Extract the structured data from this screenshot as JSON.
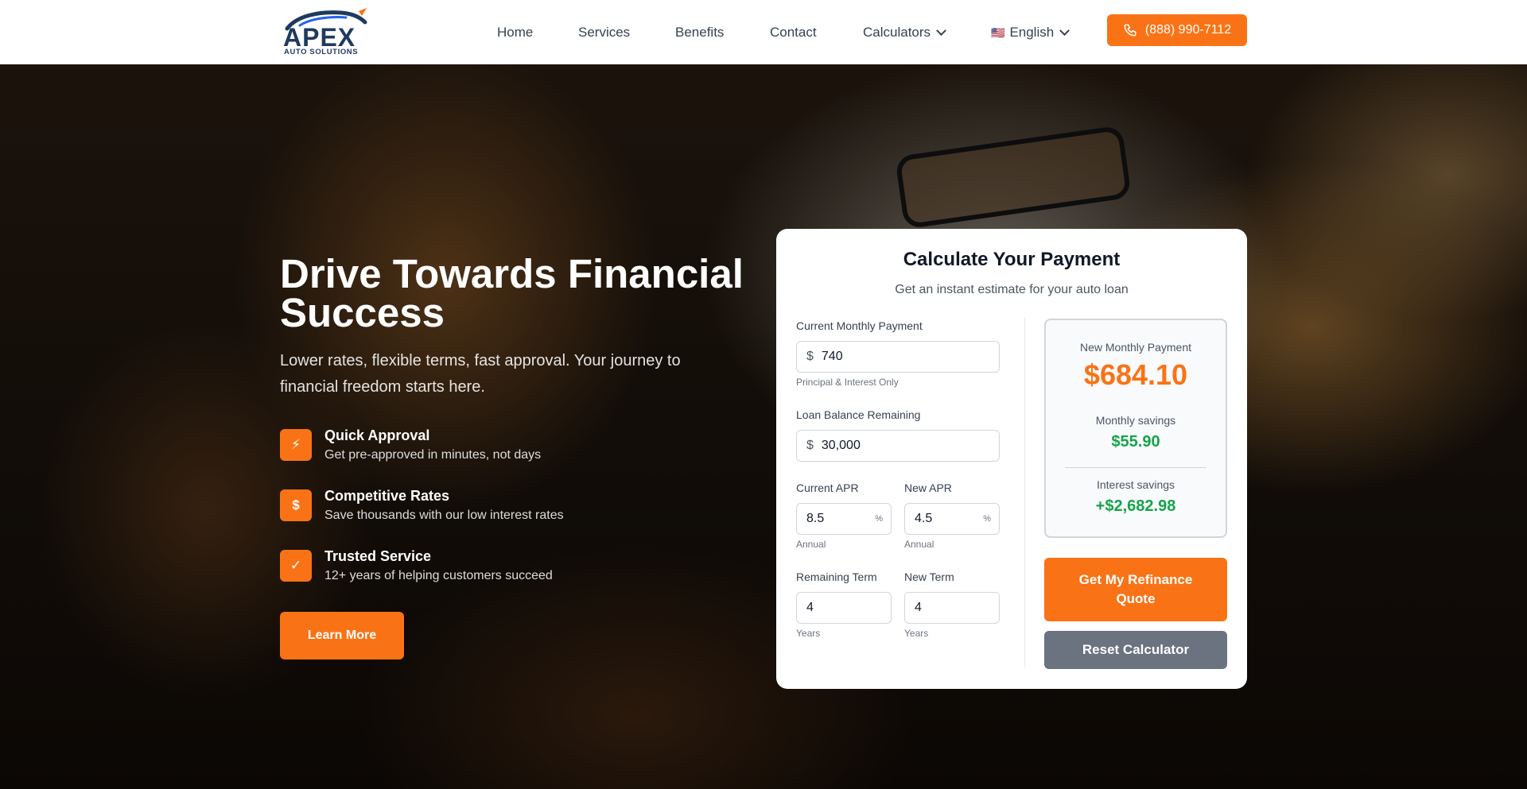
{
  "brand": {
    "name": "APEX",
    "tagline": "AUTO SOLUTIONS",
    "accent": "#f97316",
    "navy": "#1e3a5f"
  },
  "nav": {
    "home": "Home",
    "services": "Services",
    "benefits": "Benefits",
    "contact": "Contact",
    "calculators": "Calculators",
    "language_flag": "🇺🇸",
    "language": "English",
    "phone": "(888) 990-7112"
  },
  "hero": {
    "title": "Drive Towards Financial Success",
    "subtitle": "Lower rates, flexible terms, fast approval. Your journey to financial freedom starts here.",
    "features": [
      {
        "icon": "bolt-icon",
        "glyph": "⚡",
        "title": "Quick Approval",
        "desc": "Get pre-approved in minutes, not days"
      },
      {
        "icon": "dollar-icon",
        "glyph": "$",
        "title": "Competitive Rates",
        "desc": "Save thousands with our low interest rates"
      },
      {
        "icon": "shield-icon",
        "glyph": "✓",
        "title": "Trusted Service",
        "desc": "12+ years of helping customers succeed"
      }
    ],
    "cta": "Learn More"
  },
  "calculator": {
    "title": "Calculate Your Payment",
    "subtitle": "Get an instant estimate for your auto loan",
    "current_payment": {
      "label": "Current Monthly Payment",
      "prefix": "$",
      "value": "740",
      "hint": "Principal & Interest Only"
    },
    "loan_balance": {
      "label": "Loan Balance Remaining",
      "prefix": "$",
      "value": "30,000"
    },
    "current_apr": {
      "label": "Current APR",
      "value": "8.5",
      "suffix": "%",
      "hint": "Annual"
    },
    "new_apr": {
      "label": "New APR",
      "value": "4.5",
      "suffix": "%",
      "hint": "Annual"
    },
    "remaining_term": {
      "label": "Remaining Term",
      "value": "4",
      "hint": "Years"
    },
    "new_term": {
      "label": "New Term",
      "value": "4",
      "hint": "Years"
    },
    "results": {
      "new_payment_label": "New Monthly Payment",
      "new_payment": "$684.10",
      "monthly_savings_label": "Monthly savings",
      "monthly_savings": "$55.90",
      "interest_savings_label": "Interest savings",
      "interest_savings": "+$2,682.98"
    },
    "quote_button": "Get My Refinance Quote",
    "reset_button": "Reset Calculator"
  }
}
